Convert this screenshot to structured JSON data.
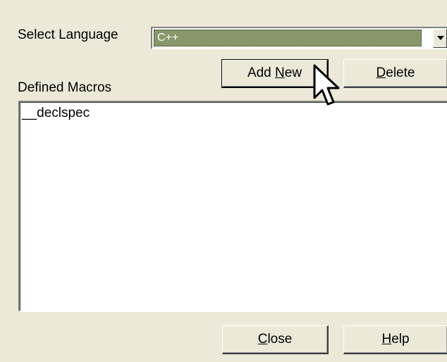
{
  "dialog": {
    "select_language_label": "Select Language",
    "defined_macros_label": "Defined Macros",
    "language_select": {
      "selected_value": "C++"
    },
    "buttons": {
      "add_new": {
        "before": "Add ",
        "accelerator": "N",
        "after": "ew"
      },
      "delete": {
        "before": "",
        "accelerator": "D",
        "after": "elete"
      },
      "close": {
        "before": "",
        "accelerator": "C",
        "after": "lose"
      },
      "help": {
        "before": "",
        "accelerator": "H",
        "after": "elp"
      }
    },
    "macros": [
      "__declspec"
    ]
  },
  "icons": {
    "combo_arrow": "chevron-down-icon",
    "mouse_pointer": "mouse-pointer-icon"
  },
  "colors": {
    "window_background": "#ece9d8",
    "selected_combo_background": "#87976a",
    "list_background": "#ffffff"
  }
}
